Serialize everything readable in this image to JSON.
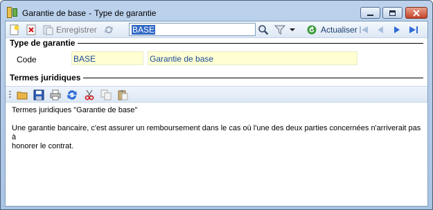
{
  "window": {
    "title_main": "Garantie de base",
    "title_separator": "-",
    "title_sub": "Type de garantie"
  },
  "toolbar": {
    "save_label": "Enregistrer",
    "search_value": "BASE",
    "refresh_label": "Actualiser"
  },
  "sections": {
    "type_title": "Type de garantie",
    "legal_title": "Termes juridiques"
  },
  "form": {
    "code_label": "Code",
    "code_value": "BASE",
    "name_value": "Garantie de base"
  },
  "editor": {
    "line1": "Termes juridiques \"Garantie de base\"",
    "line2": "Une garantie bancaire, c'est assurer un remboursement dans le cas où l'une des deux parties concernées n'arriverait pas à",
    "line3": "honorer le contrat."
  },
  "colors": {
    "field_background": "#ffffd2",
    "field_text": "#1a4a9a",
    "accent": "#2e6bd6"
  },
  "icons": [
    "app-icon",
    "minimize-icon",
    "maximize-icon",
    "close-icon",
    "new-icon",
    "delete-icon",
    "save-icon",
    "refresh-icon",
    "search-icon",
    "filter-icon",
    "dropdown-icon",
    "reload-icon",
    "first-icon",
    "previous-icon",
    "next-icon",
    "last-icon",
    "open-folder-icon",
    "save-disk-icon",
    "print-icon",
    "sync-icon",
    "cut-icon",
    "copy-icon",
    "paste-icon"
  ]
}
